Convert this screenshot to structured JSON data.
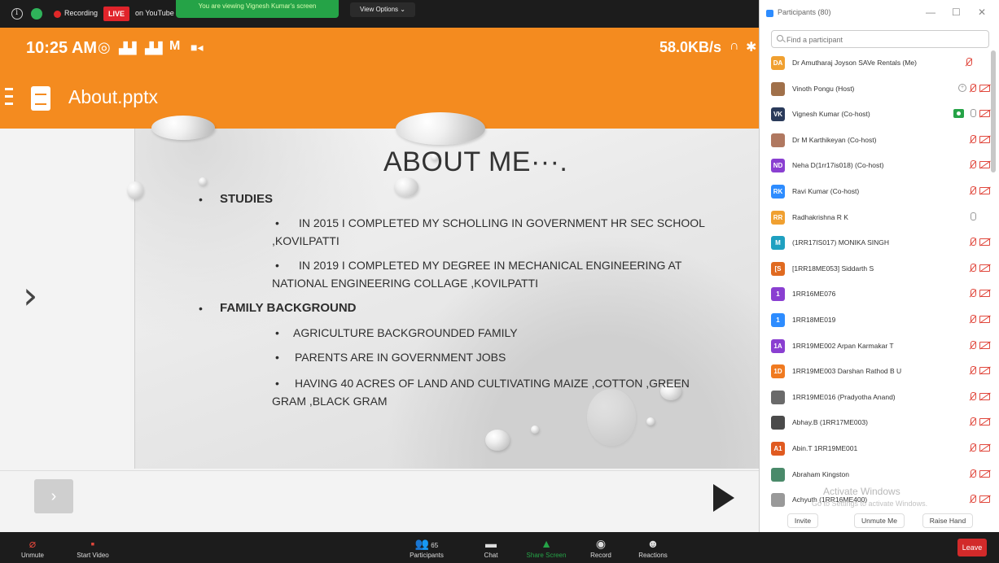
{
  "topbar": {
    "recording_label": "Recording",
    "live_label": "LIVE",
    "youtube_label": "on YouTube",
    "viewing_banner": "You are viewing Vignesh Kumar's screen",
    "view_options": "View Options ⌄"
  },
  "phone": {
    "time": "10:25 AM",
    "net_speed": "58.0KB/s",
    "file_title": "About.pptx"
  },
  "slide": {
    "heading": "ABOUT ME···.",
    "studies_label": "STUDIES",
    "study_1_line1": "IN 2015 I COMPLETED MY SCHOLLING IN  GOVERNMENT HR SEC SCHOOL",
    "study_1_line2": ",KOVILPATTI",
    "study_2_line1": "IN 2019 I COMPLETED MY DEGREE IN MECHANICAL ENGINEERING AT",
    "study_2_line2": "NATIONAL ENGINEERING COLLAGE ,KOVILPATTI",
    "family_label": "FAMILY BACKGROUND",
    "family_1": "AGRICULTURE BACKGROUNDED FAMILY",
    "family_2": "PARENTS ARE IN GOVERNMENT JOBS",
    "family_3_line1": "HAVING 40 ACRES OF LAND AND CULTIVATING MAIZE ,COTTON ,GREEN",
    "family_3_line2": "GRAM ,BLACK GRAM",
    "bullet": "•"
  },
  "panel": {
    "title": "Participants (80)",
    "search_placeholder": "Find a participant",
    "participants": [
      {
        "initials": "DA",
        "name": "Dr Amutharaj Joyson SAVe Rentals (Me)",
        "color": "#f0a030"
      },
      {
        "initials": "",
        "name": "Vinoth Pongu (Host)",
        "color": "#a0704a"
      },
      {
        "initials": "VK",
        "name": "Vignesh Kumar (Co-host)",
        "color": "#2a3a5a"
      },
      {
        "initials": "",
        "name": "Dr M Karthikeyan (Co-host)",
        "color": "#b07860"
      },
      {
        "initials": "ND",
        "name": "Neha D(1rr17is018) (Co-host)",
        "color": "#8a3fd1"
      },
      {
        "initials": "RK",
        "name": "Ravi Kumar (Co-host)",
        "color": "#2d8cff"
      },
      {
        "initials": "RR",
        "name": "Radhakrishna R K",
        "color": "#f0a030"
      },
      {
        "initials": "M",
        "name": "(1RR17IS017) MONIKA SINGH",
        "color": "#1fa0c0"
      },
      {
        "initials": "[S",
        "name": "[1RR18ME053] Siddarth S",
        "color": "#e06a20"
      },
      {
        "initials": "1",
        "name": "1RR16ME076",
        "color": "#8a3fd1"
      },
      {
        "initials": "1",
        "name": "1RR18ME019",
        "color": "#2d8cff"
      },
      {
        "initials": "1A",
        "name": "1RR19ME002 Arpan Karmakar T",
        "color": "#8a3fd1"
      },
      {
        "initials": "1D",
        "name": "1RR19ME003 Darshan Rathod B U",
        "color": "#f07a20"
      },
      {
        "initials": "",
        "name": "1RR19ME016 (Pradyotha Anand)",
        "color": "#6a6a6a"
      },
      {
        "initials": "",
        "name": "Abhay.B (1RR17ME003)",
        "color": "#4a4a4a"
      },
      {
        "initials": "A1",
        "name": "Abin.T 1RR19ME001",
        "color": "#e05a20"
      },
      {
        "initials": "",
        "name": "Abraham Kingston",
        "color": "#4a8a6a"
      },
      {
        "initials": "",
        "name": "Achyuth (1RR16ME400)",
        "color": "#999999"
      }
    ],
    "watermark": "Activate Windows",
    "watermark_sub": "Go to Settings to activate Windows.",
    "invite_label": "Invite",
    "unmute_me_label": "Unmute Me",
    "raise_hand_label": "Raise Hand"
  },
  "toolbar": {
    "unmute": "Unmute",
    "start_video": "Start Video",
    "participants": "Participants",
    "participant_count": "65",
    "chat": "Chat",
    "share_screen": "Share Screen",
    "record": "Record",
    "reactions": "Reactions",
    "leave": "Leave"
  },
  "colors": {
    "phone_orange": "#f48b1f",
    "share_green": "#25a347",
    "leave_red": "#d22a2a",
    "muted_red": "#e0473c"
  }
}
